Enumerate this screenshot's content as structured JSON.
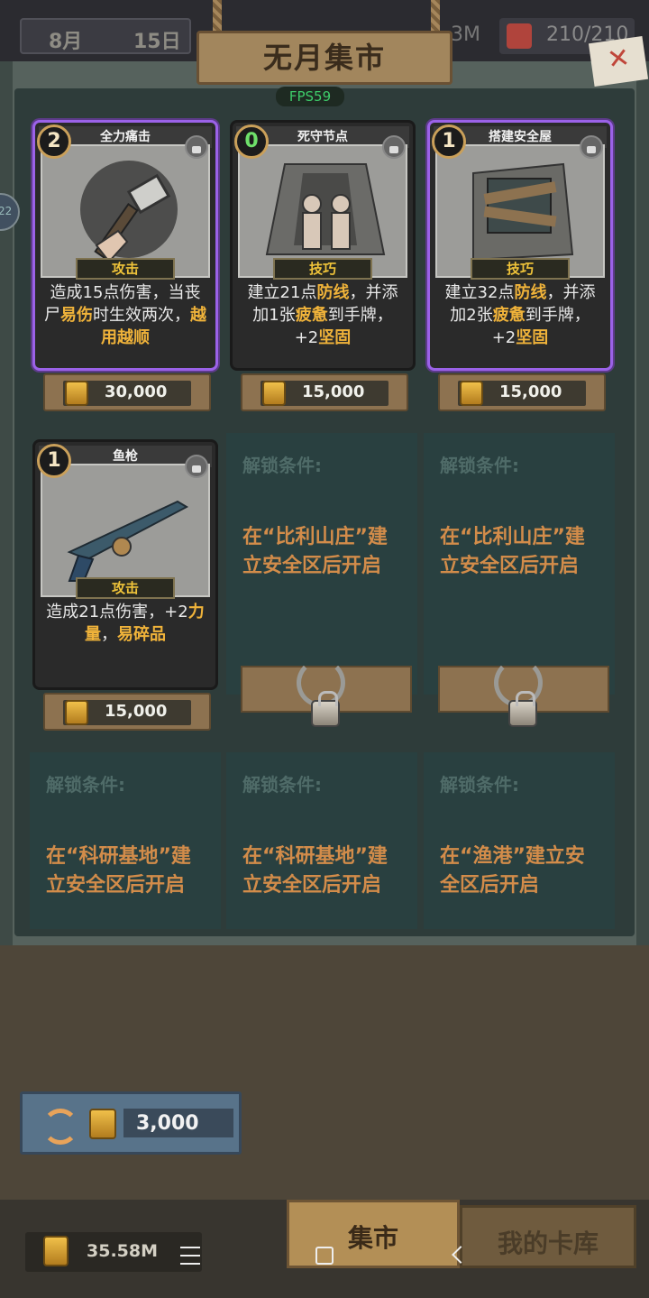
{
  "topbar": {
    "month": "8月",
    "day": "15日",
    "res_left": "3M",
    "stamina": "210/210"
  },
  "title": "无月集市",
  "fps": "FPS59",
  "side_tab": "22",
  "close_mark": "✕",
  "cards": [
    {
      "name": "全力痛击",
      "cost": "2",
      "type": "攻击",
      "desc_parts": [
        "造成15点伤害，当丧尸",
        "易伤",
        "时生效两次，",
        "越用越顺"
      ],
      "price": "30,000"
    },
    {
      "name": "死守节点",
      "cost": "0",
      "type": "技巧",
      "desc_parts": [
        "建立21点",
        "防线",
        "，并添加1张",
        "疲惫",
        "到手牌，+2",
        "坚固"
      ],
      "price": "15,000"
    },
    {
      "name": "搭建安全屋",
      "cost": "1",
      "type": "技巧",
      "desc_parts": [
        "建立32点",
        "防线",
        "，并添加2张",
        "疲惫",
        "到手牌，+2",
        "坚固"
      ],
      "price": "15,000"
    },
    {
      "name": "鱼枪",
      "cost": "1",
      "type": "攻击",
      "desc_parts": [
        "造成21点伤害，+2",
        "力量",
        "，",
        "易碎品"
      ],
      "price": "15,000"
    }
  ],
  "locked": [
    {
      "title": "解锁条件:",
      "text": "在“比利山庄”建立安全区后开启"
    },
    {
      "title": "解锁条件:",
      "text": "在“比利山庄”建立安全区后开启"
    },
    {
      "title": "解锁条件:",
      "text": "在“科研基地”建立安全区后开启"
    },
    {
      "title": "解锁条件:",
      "text": "在“科研基地”建立安全区后开启"
    },
    {
      "title": "解锁条件:",
      "text": "在“渔港”建立安全区后开启"
    }
  ],
  "refresh_cost": "3,000",
  "money": "35.58M",
  "tabs": {
    "market": "集市",
    "deck": "我的卡库"
  }
}
